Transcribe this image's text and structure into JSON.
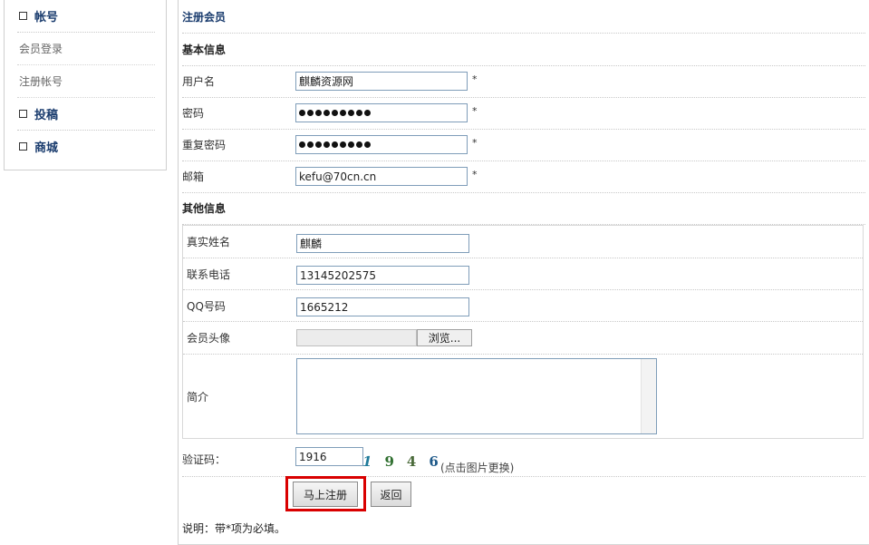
{
  "sidebar": {
    "account": "帐号",
    "login": "会员登录",
    "register": "注册帐号",
    "contribute": "投稿",
    "shop": "商城"
  },
  "form": {
    "title": "注册会员",
    "basic_title": "基本信息",
    "username_label": "用户名",
    "username_value": "麒麟资源网",
    "password_label": "密码",
    "password_confirm_label": "重复密码",
    "email_label": "邮箱",
    "email_value": "kefu@70cn.cn",
    "required_mark": "*",
    "other_title": "其他信息",
    "realname_label": "真实姓名",
    "realname_value": "麒麟",
    "phone_label": "联系电话",
    "phone_value": "13145202575",
    "qq_label": "QQ号码",
    "qq_value": "1665212",
    "avatar_label": "会员头像",
    "browse_label": "浏览...",
    "intro_label": "简介",
    "captcha_label": "验证码：",
    "captcha_value": "1916",
    "captcha_chars": [
      "1",
      "9",
      "4",
      "6"
    ],
    "captcha_colors": [
      "#1f7a9a",
      "#2f6f2f",
      "#4a6a3a",
      "#1f5a8a"
    ],
    "captcha_hint": "(点击图片更换)",
    "submit_label": "马上注册",
    "back_label": "返回",
    "note": "说明：带*项为必填。"
  }
}
